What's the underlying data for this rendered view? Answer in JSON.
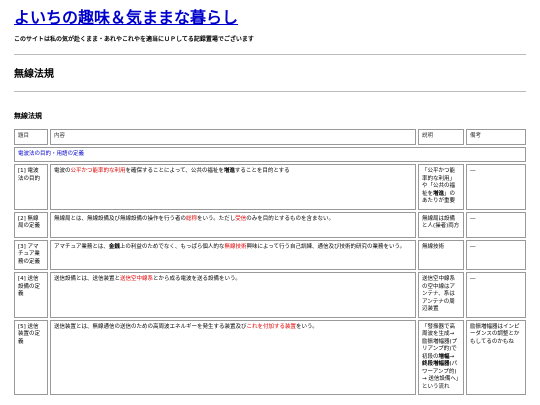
{
  "site": {
    "title": "よいちの趣味＆気ままな暮らし",
    "tagline": "このサイトは私の気が赴くまま・あれやこれやを適当にＵＰしてる記録置場でございます"
  },
  "page": {
    "heading": "無線法規",
    "subheading": "無線法規"
  },
  "table": {
    "headers": [
      "題目",
      "内容",
      "説明",
      "備考"
    ],
    "section_label": "電波法の目的・用語の定義",
    "rows": [
      {
        "title": "[1] 電波法の目的",
        "content": [
          {
            "t": "電波の",
            "s": ""
          },
          {
            "t": "公平かつ能率的な利用",
            "s": "hl"
          },
          {
            "t": "を確保することによって、公共の福祉を",
            "s": ""
          },
          {
            "t": "増進",
            "s": "bold"
          },
          {
            "t": "することを目的とする",
            "s": ""
          }
        ],
        "explain": [
          {
            "t": "「公平かつ能率的な利用」や「公共の福祉を",
            "s": ""
          },
          {
            "t": "増進",
            "s": "bold"
          },
          {
            "t": "」のあたりが重要",
            "s": ""
          }
        ],
        "note": "―"
      },
      {
        "title": "[2] 無線局の定義",
        "content": [
          {
            "t": "無線局とは、無線設備及び無線設備の操作を行う者の",
            "s": ""
          },
          {
            "t": "総称",
            "s": "hl"
          },
          {
            "t": "をいう。ただし",
            "s": ""
          },
          {
            "t": "受信",
            "s": "hl"
          },
          {
            "t": "のみを目的とするものを含まない。",
            "s": ""
          }
        ],
        "explain": [
          {
            "t": "無線局は設備と人(操者)両方",
            "s": ""
          }
        ],
        "note": "―"
      },
      {
        "title": "[3] アマチュア業務の定義",
        "content": [
          {
            "t": "アマチュア業務とは、",
            "s": ""
          },
          {
            "t": "金銭",
            "s": "bold"
          },
          {
            "t": "上の利益のためでなく、もっぱら個人的な",
            "s": ""
          },
          {
            "t": "無線技術",
            "s": "hl"
          },
          {
            "t": "興味によって行う自己訓練、通信及び技術的研究の業務をいう。",
            "s": ""
          }
        ],
        "explain": [
          {
            "t": "無線技術",
            "s": ""
          }
        ],
        "note": "―"
      },
      {
        "title": "[4] 送信設備の定義",
        "content": [
          {
            "t": "送信設備とは、送信装置と",
            "s": ""
          },
          {
            "t": "送信空中線系",
            "s": "hl"
          },
          {
            "t": "とから成る電波を送る設備をいう。",
            "s": ""
          }
        ],
        "explain": [
          {
            "t": "送信空中線系の空中線はアンテナ、系はアンテナの周辺装置",
            "s": ""
          }
        ],
        "note": "―"
      },
      {
        "title": "[5] 送信装置の定義",
        "content": [
          {
            "t": "送信装置とは、無線通信の送信のための高周波エネルギーを発生する装置及び",
            "s": ""
          },
          {
            "t": "これを付加する装置",
            "s": "hl"
          },
          {
            "t": "をいう。",
            "s": ""
          }
        ],
        "explain": [
          {
            "t": "「發振器で高周波を生成→ 励振増幅器(プリアンプ的)で初段の",
            "s": ""
          },
          {
            "t": "増幅",
            "s": "bold"
          },
          {
            "t": "→ ",
            "s": ""
          },
          {
            "t": "終段増幅器",
            "s": "bold"
          },
          {
            "t": "(パワーアンプ的) → 送信設備へ」という流れ",
            "s": ""
          }
        ],
        "note": "励振増幅器はインピーダンスの調整とかもしてるのかもね"
      }
    ]
  }
}
